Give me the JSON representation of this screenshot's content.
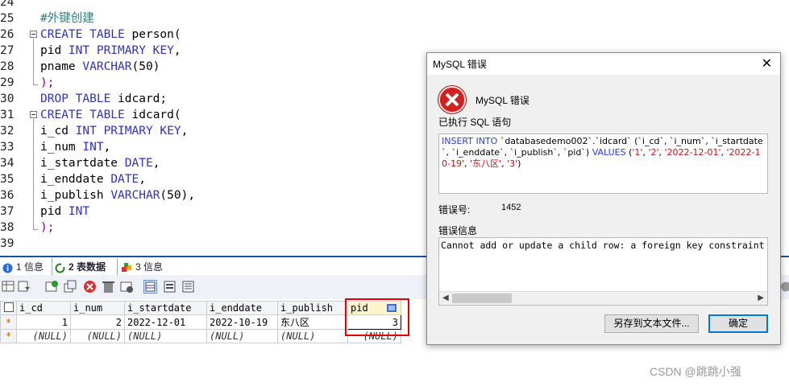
{
  "editor": {
    "lines": [
      {
        "num": "24",
        "tokens": []
      },
      {
        "num": "25",
        "tokens": [
          {
            "t": "#外键创建",
            "c": "cm"
          }
        ]
      },
      {
        "num": "26",
        "tokens": [
          {
            "t": "CREATE TABLE ",
            "c": "kw"
          },
          {
            "t": "person(",
            "c": "pl"
          }
        ]
      },
      {
        "num": "27",
        "tokens": [
          {
            "t": "pid ",
            "c": "pl"
          },
          {
            "t": "INT PRIMARY KEY",
            "c": "kw"
          },
          {
            "t": ",",
            "c": "pu"
          }
        ]
      },
      {
        "num": "28",
        "tokens": [
          {
            "t": "pname ",
            "c": "pl"
          },
          {
            "t": "VARCHAR",
            "c": "kw"
          },
          {
            "t": "(50)",
            "c": "pl"
          }
        ]
      },
      {
        "num": "29",
        "tokens": [
          {
            "t": ");",
            "c": "br"
          }
        ]
      },
      {
        "num": "30",
        "tokens": [
          {
            "t": "DROP TABLE ",
            "c": "kw"
          },
          {
            "t": "idcard;",
            "c": "pl"
          }
        ]
      },
      {
        "num": "31",
        "tokens": [
          {
            "t": "CREATE TABLE ",
            "c": "kw"
          },
          {
            "t": "idcard(",
            "c": "pl"
          }
        ]
      },
      {
        "num": "32",
        "tokens": [
          {
            "t": "i_cd ",
            "c": "pl"
          },
          {
            "t": "INT PRIMARY KEY",
            "c": "kw"
          },
          {
            "t": ",",
            "c": "pu"
          }
        ]
      },
      {
        "num": "33",
        "tokens": [
          {
            "t": "i_num ",
            "c": "pl"
          },
          {
            "t": "INT",
            "c": "kw"
          },
          {
            "t": ",",
            "c": "pu"
          }
        ]
      },
      {
        "num": "34",
        "tokens": [
          {
            "t": "i_startdate ",
            "c": "pl"
          },
          {
            "t": "DATE",
            "c": "kw"
          },
          {
            "t": ",",
            "c": "pu"
          }
        ]
      },
      {
        "num": "35",
        "tokens": [
          {
            "t": "i_enddate ",
            "c": "pl"
          },
          {
            "t": "DATE",
            "c": "kw"
          },
          {
            "t": ",",
            "c": "pu"
          }
        ]
      },
      {
        "num": "36",
        "tokens": [
          {
            "t": "i_publish ",
            "c": "pl"
          },
          {
            "t": "VARCHAR",
            "c": "kw"
          },
          {
            "t": "(50),",
            "c": "pl"
          }
        ]
      },
      {
        "num": "37",
        "tokens": [
          {
            "t": "pid ",
            "c": "pl"
          },
          {
            "t": "INT",
            "c": "kw"
          }
        ]
      },
      {
        "num": "38",
        "tokens": [
          {
            "t": ");",
            "c": "br"
          }
        ]
      },
      {
        "num": "39",
        "tokens": []
      }
    ]
  },
  "tabs": [
    {
      "label": "1 信息",
      "active": false
    },
    {
      "label": "2 表数据",
      "active": true
    },
    {
      "label": "3 信息",
      "active": false
    }
  ],
  "grid": {
    "columns": [
      "i_cd",
      "i_num",
      "i_startdate",
      "i_enddate",
      "i_publish",
      "pid"
    ],
    "rows": [
      {
        "marker": "*",
        "cells": [
          "1",
          "2",
          "2022-12-01",
          "2022-10-19",
          "东八区",
          "3"
        ]
      },
      {
        "marker": "*",
        "cells": [
          "(NULL)",
          "(NULL)",
          "(NULL)",
          "(NULL)",
          "(NULL)",
          "(NULL)"
        ]
      }
    ]
  },
  "dialog": {
    "title": "MySQL 错误",
    "heading": "MySQL 错误",
    "executed_label": "已执行 SQL 语句",
    "sql": [
      {
        "t": "INSERT INTO ",
        "c": "k"
      },
      {
        "t": "`databasedemo002`.`idcard` (`i_cd`, `i_num`, `i_startdate`, `i_enddate`, `i_publish`, `pid`) ",
        "c": "p"
      },
      {
        "t": "VALUES ",
        "c": "k"
      },
      {
        "t": "(",
        "c": "p"
      },
      {
        "t": "'1'",
        "c": "s"
      },
      {
        "t": ", ",
        "c": "p"
      },
      {
        "t": "'2'",
        "c": "s"
      },
      {
        "t": ", ",
        "c": "p"
      },
      {
        "t": "'2022-12-01'",
        "c": "s"
      },
      {
        "t": ", ",
        "c": "p"
      },
      {
        "t": "'2022-10-19'",
        "c": "s"
      },
      {
        "t": ", ",
        "c": "p"
      },
      {
        "t": "'东八区'",
        "c": "s"
      },
      {
        "t": ", ",
        "c": "p"
      },
      {
        "t": "'3'",
        "c": "s"
      },
      {
        "t": ")",
        "c": "p"
      }
    ],
    "errno_label": "错误号:",
    "errno_value": "1452",
    "errinfo_label": "错误信息",
    "errinfo_text": "Cannot add or update a child row: a foreign key constraint fails (`data",
    "save_button": "另存到文本文件...",
    "ok_button": "确定",
    "close_glyph": "✕"
  },
  "watermark": "CSDN @跳跳小强",
  "colors": {
    "accent": "#1e50a0",
    "error_red": "#d21f1f",
    "highlight_box": "#e00000"
  }
}
